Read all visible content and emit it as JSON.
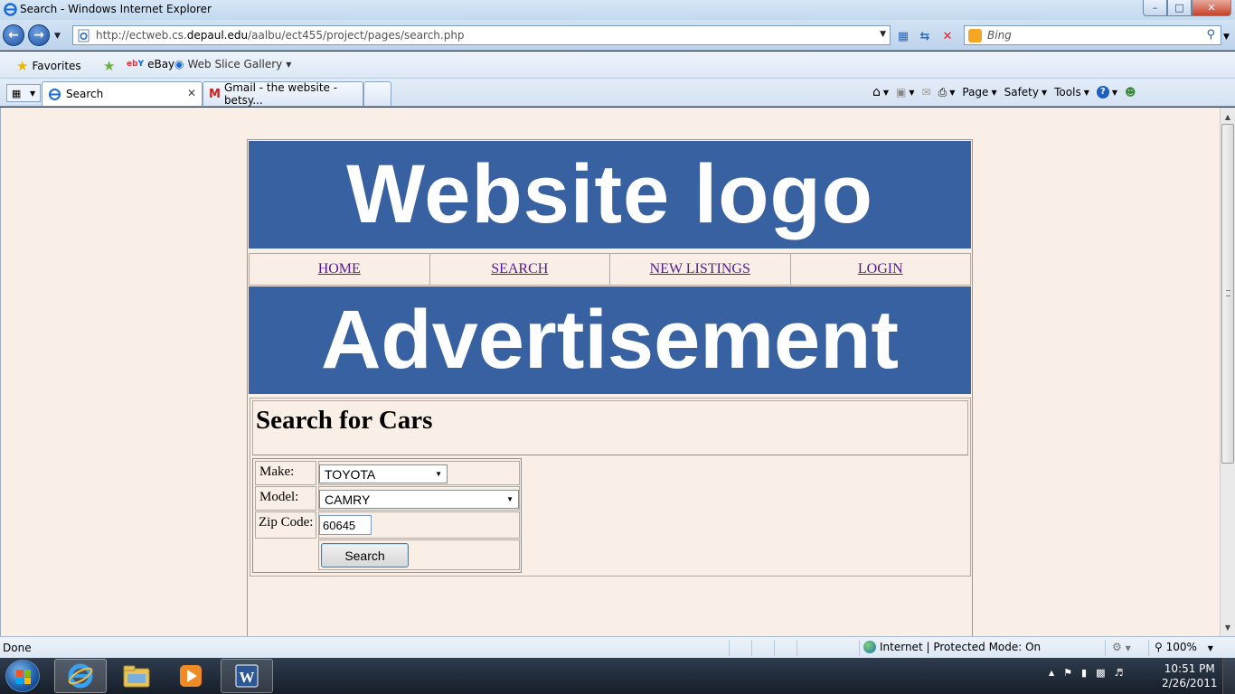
{
  "window": {
    "title": "Search - Windows Internet Explorer",
    "minimize": "–",
    "maximize": "□",
    "close": "✕"
  },
  "address_bar": {
    "url_prefix": "http://ectweb.cs.",
    "url_domain": "depaul.edu",
    "url_path": "/aalbu/ect455/project/pages/search.php"
  },
  "search_box": {
    "placeholder": "Bing"
  },
  "favorites_bar": {
    "favorites_label": "Favorites",
    "items": [
      {
        "label": "eBay",
        "icon": "ebay-icon"
      },
      {
        "label": "Web Slice Gallery",
        "icon": "web-slice-icon"
      }
    ]
  },
  "tabs": [
    {
      "label": "Search",
      "active": true
    },
    {
      "label": "Gmail - the website - betsy...",
      "active": false
    }
  ],
  "command_bar": {
    "page": "Page",
    "safety": "Safety",
    "tools": "Tools"
  },
  "site": {
    "logo_text": "Website logo",
    "nav": [
      "HOME",
      "SEARCH",
      "NEW LISTINGS",
      "LOGIN"
    ],
    "ad_text": "Advertisement",
    "link_color": "#551a8b",
    "banner_color": "#3861a1",
    "background_color": "#faefe6"
  },
  "search_form": {
    "heading": "Search for Cars",
    "make_label": "Make:",
    "make_value": "TOYOTA",
    "model_label": "Model:",
    "model_value": "CAMRY",
    "zip_label": "Zip Code:",
    "zip_value": "60645",
    "submit_label": "Search"
  },
  "status_bar": {
    "status": "Done",
    "zone": "Internet | Protected Mode: On",
    "zoom": "100%"
  },
  "taskbar": {
    "time": "10:51 PM",
    "date": "2/26/2011"
  }
}
